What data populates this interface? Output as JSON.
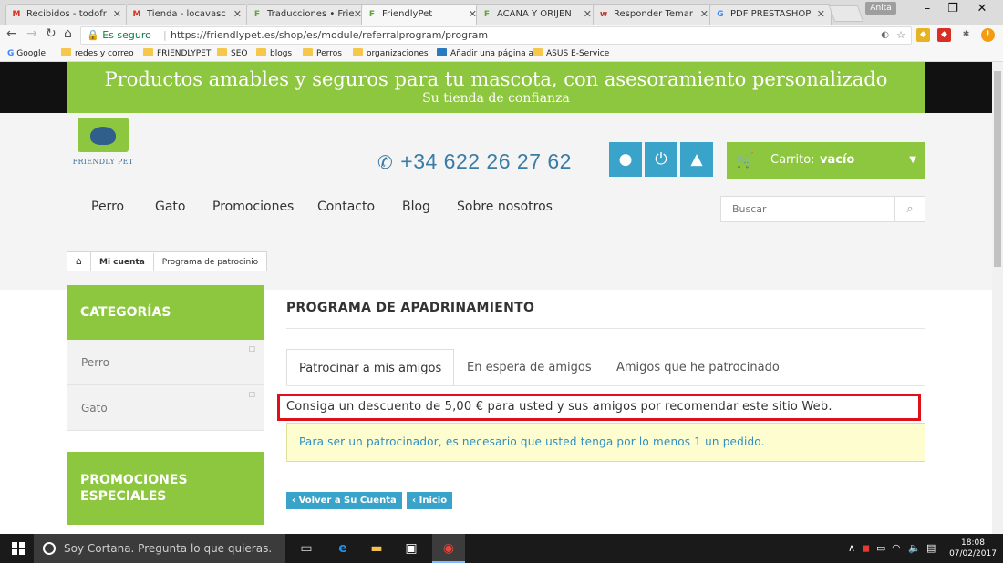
{
  "browser": {
    "tabs": [
      {
        "title": "Recibidos - todofr",
        "favicon": "M",
        "favicon_color": "#d93025"
      },
      {
        "title": "Tienda - locavasc",
        "favicon": "M",
        "favicon_color": "#d93025"
      },
      {
        "title": "Traducciones • Frie",
        "favicon": "F",
        "favicon_color": "#5aa832"
      },
      {
        "title": "FriendlyPet",
        "favicon": "F",
        "favicon_color": "#5aa832"
      },
      {
        "title": "ACANA Y ORIJEN",
        "favicon": "F",
        "favicon_color": "#5aa832"
      },
      {
        "title": "Responder Temar",
        "favicon": "w",
        "favicon_color": "#c0392b"
      },
      {
        "title": "PDF PRESTASHOP",
        "favicon": "G",
        "favicon_color": "#4285f4"
      }
    ],
    "active_tab_index": 3,
    "profile_name": "Anita",
    "secure_label": "Es seguro",
    "url": "https://friendlypet.es/shop/es/module/referralprogram/program",
    "bookmarks": [
      "Google",
      "redes y correo",
      "FRIENDLYPET",
      "SEO",
      "blogs",
      "Perros",
      "organizaciones",
      "Añadir una página a C",
      "ASUS E-Service"
    ]
  },
  "page": {
    "banner": {
      "line1": "Productos amables y seguros para tu mascota, con asesoramiento personalizado",
      "line2": "Su tienda de confianza"
    },
    "logo_text": "FRIENDLY PET",
    "phone": "+34 622 26 27 62",
    "cart": {
      "label": "Carrito:",
      "value": "vacío"
    },
    "nav": [
      "Perro",
      "Gato",
      "Promociones",
      "Contacto",
      "Blog",
      "Sobre nosotros"
    ],
    "search_placeholder": "Buscar",
    "breadcrumb": [
      "Mi cuenta",
      "Programa de patrocinio"
    ],
    "sidebar": {
      "categories_title": "CATEGORÍAS",
      "categories": [
        "Perro",
        "Gato"
      ],
      "promo_title_1": "PROMOCIONES",
      "promo_title_2": "ESPECIALES"
    },
    "content": {
      "title": "PROGRAMA DE APADRINAMIENTO",
      "tabs": [
        "Patrocinar a mis amigos",
        "En espera de amigos",
        "Amigos que he patrocinado"
      ],
      "active_tab": 0,
      "notice": "Consiga un descuento de 5,00 € para usted y sus amigos por recomendar este sitio Web.",
      "alert": "Para ser un patrocinador, es necesario que usted tenga por lo menos 1 un pedido.",
      "back_button": "Volver a Su Cuenta",
      "home_button": "Inicio"
    },
    "accent_color": "#8dc63f",
    "button_color": "#3aa3c9",
    "highlight_color": "#e0101a"
  },
  "taskbar": {
    "cortana_placeholder": "Soy Cortana. Pregunta lo que quieras.",
    "time": "18:08",
    "date": "07/02/2017"
  }
}
